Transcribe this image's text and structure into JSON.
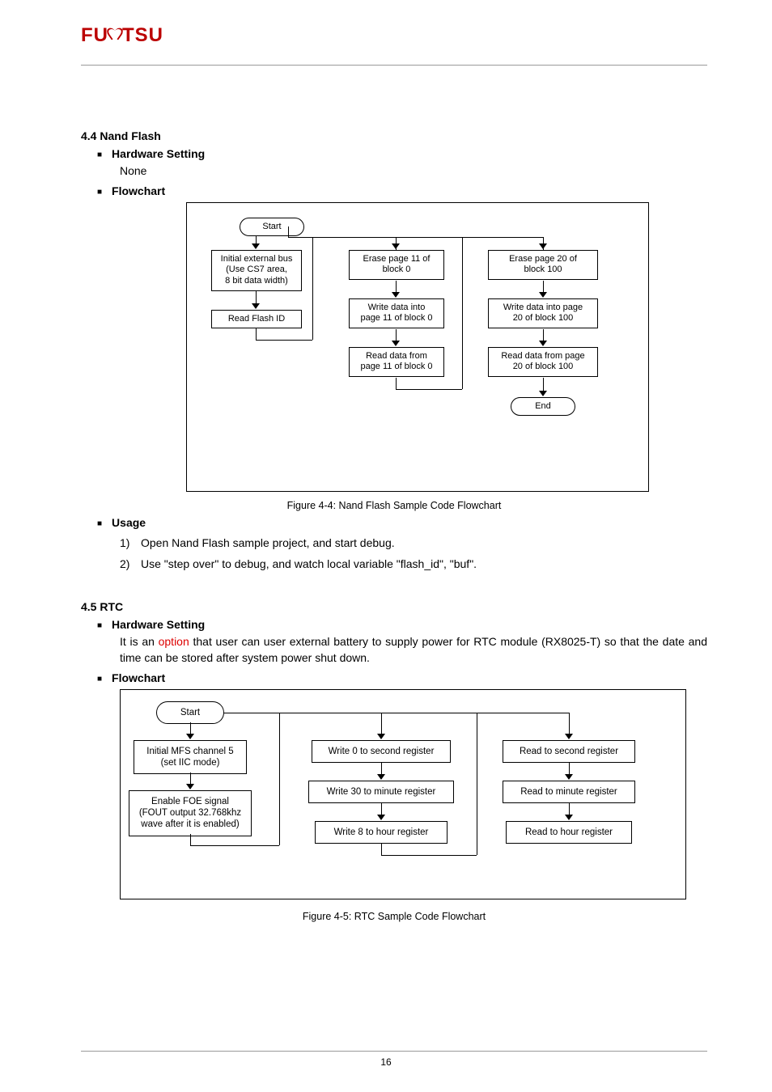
{
  "logo": {
    "pre": "FU",
    "post": "TSU"
  },
  "section1": {
    "title": "4.4 Nand Flash",
    "hw_label": "Hardware Setting",
    "hw_value": "None",
    "flow_label": "Flowchart",
    "usage_label": "Usage",
    "caption": "Figure 4-4:  Nand Flash Sample Code Flowchart",
    "boxes": {
      "start": "Start",
      "init": "Initial external bus\n(Use CS7 area,\n8 bit data width)",
      "readid": "Read Flash ID",
      "erase0": "Erase page 11 of\nblock 0",
      "write0": "Write data into\npage 11 of block 0",
      "read0": "Read data from\npage 11 of block 0",
      "erase100": "Erase page 20 of\nblock 100",
      "write100": "Write data into page\n20 of block 100",
      "read100": "Read data from page\n20 of block 100",
      "end": "End"
    },
    "usage": [
      "Open Nand Flash sample project, and start debug.",
      "Use \"step over\" to debug, and watch local variable \"flash_id\", \"buf\"."
    ]
  },
  "section2": {
    "title": "4.5 RTC",
    "hw_label": "Hardware Setting",
    "hw_text_pre": "It is an ",
    "hw_text_red": "option",
    "hw_text_post": " that user can user external battery to supply power for RTC module (RX8025-T) so that the date and time can be stored after system power shut down.",
    "flow_label": "Flowchart",
    "caption": "Figure 4-5:  RTC Sample Code Flowchart",
    "boxes": {
      "start": "Start",
      "init": "Initial MFS channel 5\n(set IIC mode)",
      "foe": "Enable FOE signal\n(FOUT output 32.768khz\nwave after it is enabled)",
      "w0": "Write 0 to second register",
      "w30": "Write 30 to minute register",
      "w8": "Write 8 to hour register",
      "r_sec": "Read to second register",
      "r_min": "Read to minute register",
      "r_hr": "Read to hour register"
    }
  },
  "page": "16"
}
